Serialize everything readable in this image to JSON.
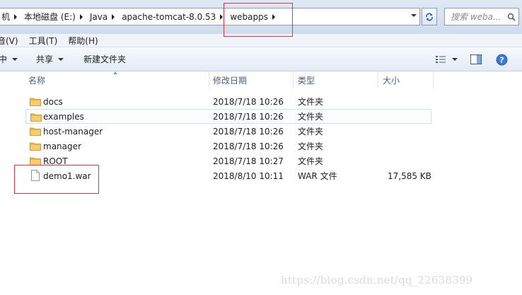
{
  "address": {
    "crumbs": [
      "机",
      "本地磁盘 (E:)",
      "Java",
      "apache-tomcat-8.0.53",
      "webapps"
    ]
  },
  "search": {
    "placeholder": "搜索 weba..."
  },
  "menu": [
    "音(V)",
    "工具(T)",
    "帮助(H)"
  ],
  "toolbar": {
    "organize_label": "中",
    "share_label": "共享",
    "new_folder_label": "新建文件夹"
  },
  "columns": {
    "name": "名称",
    "modified": "修改日期",
    "type": "类型",
    "size": "大小"
  },
  "files": [
    {
      "name": "docs",
      "modified": "2018/7/18 10:26",
      "type": "文件夹",
      "size": "",
      "icon": "folder-icon"
    },
    {
      "name": "examples",
      "modified": "2018/7/18 10:26",
      "type": "文件夹",
      "size": "",
      "icon": "folder-icon"
    },
    {
      "name": "host-manager",
      "modified": "2018/7/18 10:26",
      "type": "文件夹",
      "size": "",
      "icon": "folder-icon"
    },
    {
      "name": "manager",
      "modified": "2018/7/18 10:26",
      "type": "文件夹",
      "size": "",
      "icon": "folder-icon"
    },
    {
      "name": "ROOT",
      "modified": "2018/7/18 10:27",
      "type": "文件夹",
      "size": "",
      "icon": "folder-icon"
    },
    {
      "name": "demo1.war",
      "modified": "2018/8/10 10:11",
      "type": "WAR 文件",
      "size": "17,585 KB",
      "icon": "file-icon"
    }
  ],
  "watermark": "https://blog.csdn.net/qq_22638399",
  "colors": {
    "highlight": "#e8343a",
    "folder": "#e8b64c",
    "accent": "#2b5fa8"
  }
}
